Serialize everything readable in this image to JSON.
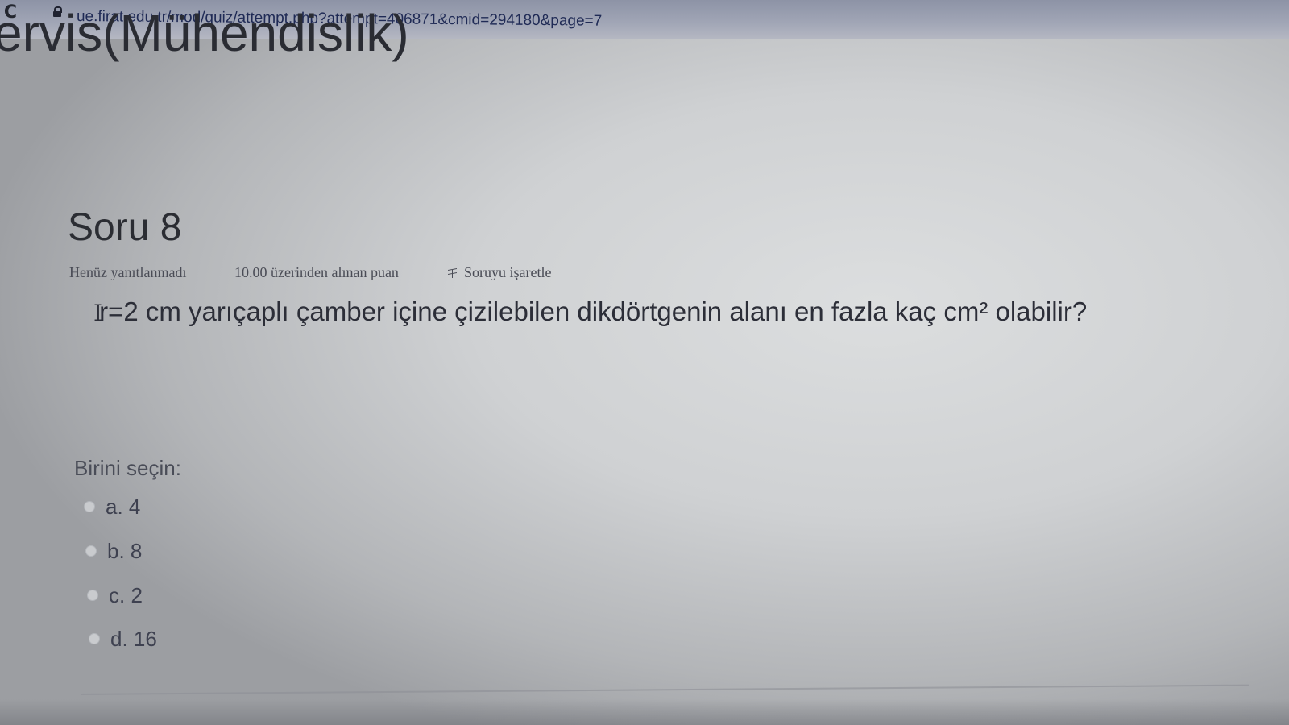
{
  "browser": {
    "url": "ue.firat.edu.tr/mod/quiz/attempt.php?attempt=406871&cmid=294180&page=7",
    "reload_glyph": "C",
    "icons": [
      "reload-icon",
      "lock-icon"
    ]
  },
  "course": {
    "title_fragment": "ervis(Mühendislik)"
  },
  "question": {
    "title": "Soru 8",
    "state": "Henüz yanıtlanmadı",
    "grade": "10.00 üzerinden alınan puan",
    "flag_label": "Soruyu işaretle",
    "cursor": "I",
    "text": "r=2 cm yarıçaplı çamber içine çizilebilen dikdörtgenin alanı en fazla kaç cm² olabilir?"
  },
  "answers": {
    "prompt": "Birini seçin:",
    "options": [
      {
        "label": "a. 4"
      },
      {
        "label": "b. 8"
      },
      {
        "label": "c. 2"
      },
      {
        "label": "d. 16"
      }
    ]
  },
  "colors": {
    "address_bar": "#a1a6b6",
    "url_text": "#1f2a55",
    "page_text": "#2a2c31"
  }
}
